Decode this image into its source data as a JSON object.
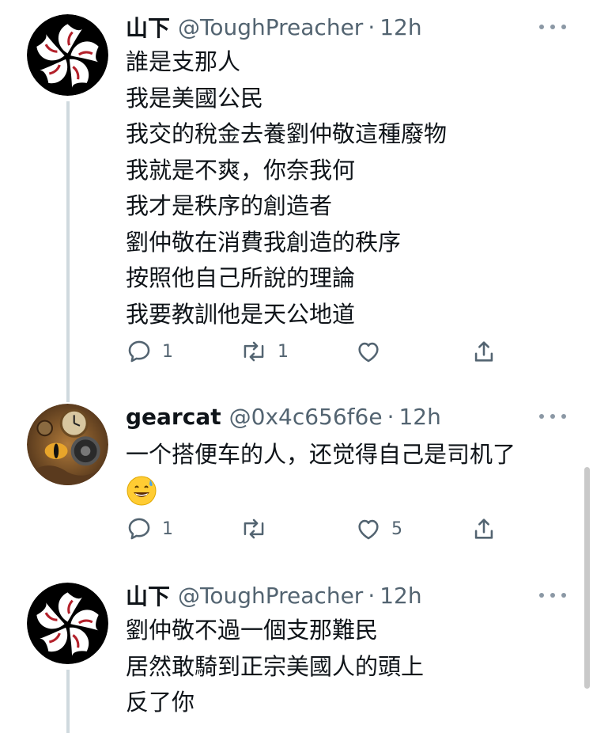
{
  "tweets": [
    {
      "name": "山下",
      "handle": "@ToughPreacher",
      "dot": "·",
      "time": "12h",
      "avatar_icon": "bauhinia-flag-avatar",
      "lines": [
        "誰是支那人",
        "我是美國公民",
        "我交的稅金去養劉仲敬這種廢物",
        "我就是不爽，你奈我何",
        "我才是秩序的創造者",
        "劉仲敬在消費我創造的秩序",
        "按照他自己所說的理論",
        "我要教訓他是天公地道"
      ],
      "reply_count": "1",
      "retweet_count": "1",
      "like_count": ""
    },
    {
      "name": "gearcat",
      "handle": "@0x4c656f6e",
      "dot": "·",
      "time": "12h",
      "avatar_icon": "steampunk-cat-avatar",
      "lines": [
        "一个搭便车的人，还觉得自己是司机了"
      ],
      "emoji": "sweat-smile-emoji",
      "reply_count": "1",
      "retweet_count": "",
      "like_count": "5"
    },
    {
      "name": "山下",
      "handle": "@ToughPreacher",
      "dot": "·",
      "time": "12h",
      "avatar_icon": "bauhinia-flag-avatar",
      "lines": [
        "劉仲敬不過一個支那難民",
        "居然敢騎到正宗美國人的頭上",
        "反了你"
      ]
    }
  ],
  "colors": {
    "text": "#0f1419",
    "secondary": "#536471",
    "thread": "#cfd9de",
    "avatar_bg": "#000000",
    "flower_red": "#b3202a"
  }
}
